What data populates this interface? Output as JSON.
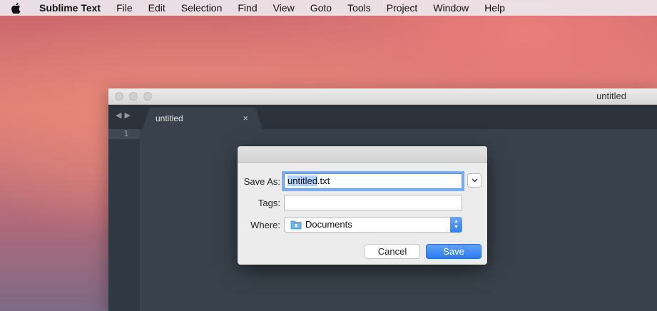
{
  "menubar": {
    "apple_icon": "apple-logo",
    "app_name": "Sublime Text",
    "items": [
      "File",
      "Edit",
      "Selection",
      "Find",
      "View",
      "Goto",
      "Tools",
      "Project",
      "Window",
      "Help"
    ]
  },
  "window": {
    "title": "untitled",
    "tab": {
      "label": "untitled",
      "close_glyph": "×"
    },
    "nav_back": "◀",
    "nav_forward": "▶",
    "line_number": "1"
  },
  "dialog": {
    "save_as_label": "Save As:",
    "filename_selected_part": "untitled",
    "filename_extension": ".txt",
    "tags_label": "Tags:",
    "tags_value": "",
    "where_label": "Where:",
    "where_value": "Documents",
    "cancel_label": "Cancel",
    "save_label": "Save"
  },
  "colors": {
    "accent": "#2b7bf3",
    "editor_bg": "#39424b",
    "tabbar_bg": "#2c333b"
  }
}
